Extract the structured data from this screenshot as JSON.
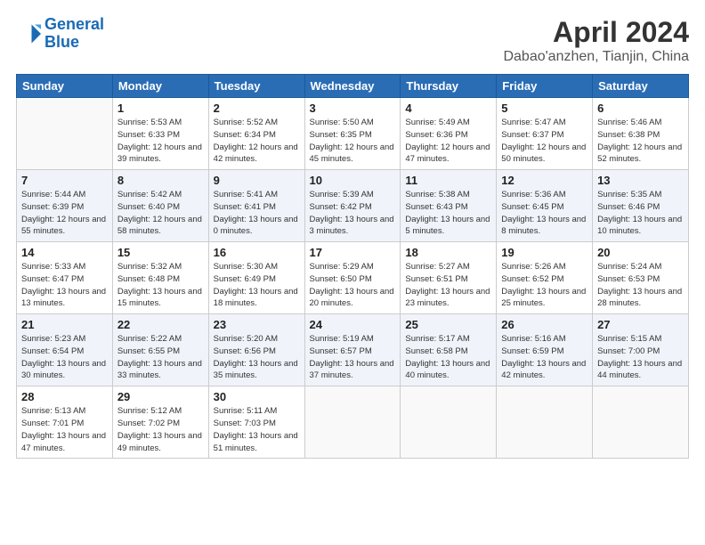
{
  "header": {
    "logo_line1": "General",
    "logo_line2": "Blue",
    "title": "April 2024",
    "subtitle": "Dabao'anzhen, Tianjin, China"
  },
  "weekdays": [
    "Sunday",
    "Monday",
    "Tuesday",
    "Wednesday",
    "Thursday",
    "Friday",
    "Saturday"
  ],
  "weeks": [
    [
      {
        "day": "",
        "info": ""
      },
      {
        "day": "1",
        "info": "Sunrise: 5:53 AM\nSunset: 6:33 PM\nDaylight: 12 hours\nand 39 minutes."
      },
      {
        "day": "2",
        "info": "Sunrise: 5:52 AM\nSunset: 6:34 PM\nDaylight: 12 hours\nand 42 minutes."
      },
      {
        "day": "3",
        "info": "Sunrise: 5:50 AM\nSunset: 6:35 PM\nDaylight: 12 hours\nand 45 minutes."
      },
      {
        "day": "4",
        "info": "Sunrise: 5:49 AM\nSunset: 6:36 PM\nDaylight: 12 hours\nand 47 minutes."
      },
      {
        "day": "5",
        "info": "Sunrise: 5:47 AM\nSunset: 6:37 PM\nDaylight: 12 hours\nand 50 minutes."
      },
      {
        "day": "6",
        "info": "Sunrise: 5:46 AM\nSunset: 6:38 PM\nDaylight: 12 hours\nand 52 minutes."
      }
    ],
    [
      {
        "day": "7",
        "info": "Sunrise: 5:44 AM\nSunset: 6:39 PM\nDaylight: 12 hours\nand 55 minutes."
      },
      {
        "day": "8",
        "info": "Sunrise: 5:42 AM\nSunset: 6:40 PM\nDaylight: 12 hours\nand 58 minutes."
      },
      {
        "day": "9",
        "info": "Sunrise: 5:41 AM\nSunset: 6:41 PM\nDaylight: 13 hours\nand 0 minutes."
      },
      {
        "day": "10",
        "info": "Sunrise: 5:39 AM\nSunset: 6:42 PM\nDaylight: 13 hours\nand 3 minutes."
      },
      {
        "day": "11",
        "info": "Sunrise: 5:38 AM\nSunset: 6:43 PM\nDaylight: 13 hours\nand 5 minutes."
      },
      {
        "day": "12",
        "info": "Sunrise: 5:36 AM\nSunset: 6:45 PM\nDaylight: 13 hours\nand 8 minutes."
      },
      {
        "day": "13",
        "info": "Sunrise: 5:35 AM\nSunset: 6:46 PM\nDaylight: 13 hours\nand 10 minutes."
      }
    ],
    [
      {
        "day": "14",
        "info": "Sunrise: 5:33 AM\nSunset: 6:47 PM\nDaylight: 13 hours\nand 13 minutes."
      },
      {
        "day": "15",
        "info": "Sunrise: 5:32 AM\nSunset: 6:48 PM\nDaylight: 13 hours\nand 15 minutes."
      },
      {
        "day": "16",
        "info": "Sunrise: 5:30 AM\nSunset: 6:49 PM\nDaylight: 13 hours\nand 18 minutes."
      },
      {
        "day": "17",
        "info": "Sunrise: 5:29 AM\nSunset: 6:50 PM\nDaylight: 13 hours\nand 20 minutes."
      },
      {
        "day": "18",
        "info": "Sunrise: 5:27 AM\nSunset: 6:51 PM\nDaylight: 13 hours\nand 23 minutes."
      },
      {
        "day": "19",
        "info": "Sunrise: 5:26 AM\nSunset: 6:52 PM\nDaylight: 13 hours\nand 25 minutes."
      },
      {
        "day": "20",
        "info": "Sunrise: 5:24 AM\nSunset: 6:53 PM\nDaylight: 13 hours\nand 28 minutes."
      }
    ],
    [
      {
        "day": "21",
        "info": "Sunrise: 5:23 AM\nSunset: 6:54 PM\nDaylight: 13 hours\nand 30 minutes."
      },
      {
        "day": "22",
        "info": "Sunrise: 5:22 AM\nSunset: 6:55 PM\nDaylight: 13 hours\nand 33 minutes."
      },
      {
        "day": "23",
        "info": "Sunrise: 5:20 AM\nSunset: 6:56 PM\nDaylight: 13 hours\nand 35 minutes."
      },
      {
        "day": "24",
        "info": "Sunrise: 5:19 AM\nSunset: 6:57 PM\nDaylight: 13 hours\nand 37 minutes."
      },
      {
        "day": "25",
        "info": "Sunrise: 5:17 AM\nSunset: 6:58 PM\nDaylight: 13 hours\nand 40 minutes."
      },
      {
        "day": "26",
        "info": "Sunrise: 5:16 AM\nSunset: 6:59 PM\nDaylight: 13 hours\nand 42 minutes."
      },
      {
        "day": "27",
        "info": "Sunrise: 5:15 AM\nSunset: 7:00 PM\nDaylight: 13 hours\nand 44 minutes."
      }
    ],
    [
      {
        "day": "28",
        "info": "Sunrise: 5:13 AM\nSunset: 7:01 PM\nDaylight: 13 hours\nand 47 minutes."
      },
      {
        "day": "29",
        "info": "Sunrise: 5:12 AM\nSunset: 7:02 PM\nDaylight: 13 hours\nand 49 minutes."
      },
      {
        "day": "30",
        "info": "Sunrise: 5:11 AM\nSunset: 7:03 PM\nDaylight: 13 hours\nand 51 minutes."
      },
      {
        "day": "",
        "info": ""
      },
      {
        "day": "",
        "info": ""
      },
      {
        "day": "",
        "info": ""
      },
      {
        "day": "",
        "info": ""
      }
    ]
  ]
}
